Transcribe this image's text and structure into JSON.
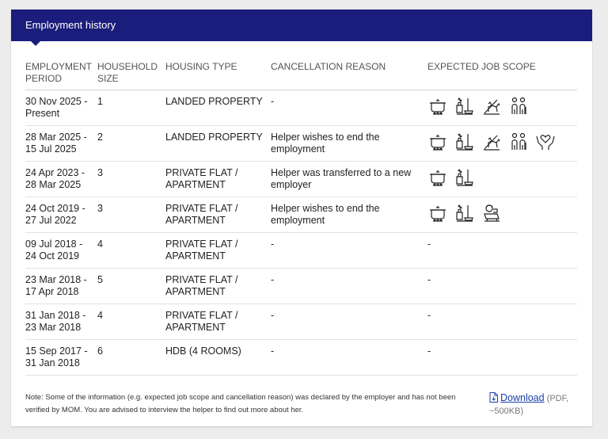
{
  "panel": {
    "title": "Employment history"
  },
  "columns": {
    "period": "EMPLOYMENT PERIOD",
    "household": "HOUSEHOLD SIZE",
    "housing": "HOUSING TYPE",
    "reason": "CANCELLATION REASON",
    "scope": "EXPECTED JOB SCOPE"
  },
  "rows": [
    {
      "period": "30 Nov 2025 - Present",
      "household": "1",
      "housing": "LANDED PROPERTY",
      "reason": "-",
      "scope": [
        "cooking-icon",
        "cleaning-icon",
        "pet-care-icon",
        "elderly-care-icon"
      ]
    },
    {
      "period": "28 Mar 2025 - 15 Jul 2025",
      "household": "2",
      "housing": "LANDED PROPERTY",
      "reason": "Helper wishes to end the employment",
      "scope": [
        "cooking-icon",
        "cleaning-icon",
        "pet-care-icon",
        "elderly-care-icon",
        "caregiving-icon"
      ]
    },
    {
      "period": "24 Apr 2023 - 28 Mar 2025",
      "household": "3",
      "housing": "PRIVATE FLAT / APARTMENT",
      "reason": "Helper was transferred to a new employer",
      "scope": [
        "cooking-icon",
        "cleaning-icon"
      ]
    },
    {
      "period": "24 Oct 2019 - 27 Jul 2022",
      "household": "3",
      "housing": "PRIVATE FLAT / APARTMENT",
      "reason": "Helper wishes to end the employment",
      "scope": [
        "cooking-icon",
        "cleaning-icon",
        "child-care-icon"
      ]
    },
    {
      "period": "09 Jul 2018 - 24 Oct 2019",
      "household": "4",
      "housing": "PRIVATE FLAT / APARTMENT",
      "reason": "-",
      "scope": [],
      "scope_text": "-"
    },
    {
      "period": "23 Mar 2018 - 17 Apr 2018",
      "household": "5",
      "housing": "PRIVATE FLAT / APARTMENT",
      "reason": "-",
      "scope": [],
      "scope_text": "-"
    },
    {
      "period": "31 Jan 2018 - 23 Mar 2018",
      "household": "4",
      "housing": "PRIVATE FLAT / APARTMENT",
      "reason": "-",
      "scope": [],
      "scope_text": "-"
    },
    {
      "period": "15 Sep 2017 - 31 Jan 2018",
      "household": "6",
      "housing": "HDB (4 ROOMS)",
      "reason": "-",
      "scope": [],
      "scope_text": "-"
    }
  ],
  "footer": {
    "note": "Note: Some of the information (e.g. expected job scope and cancellation reason) was declared by the employer and has not been verified by MOM. You are advised to interview the helper to find out more about her.",
    "download_label": "Download",
    "download_meta": "(PDF, ~500KB)"
  },
  "colors": {
    "header": "#1b1d7c",
    "link": "#1b3fa8"
  }
}
